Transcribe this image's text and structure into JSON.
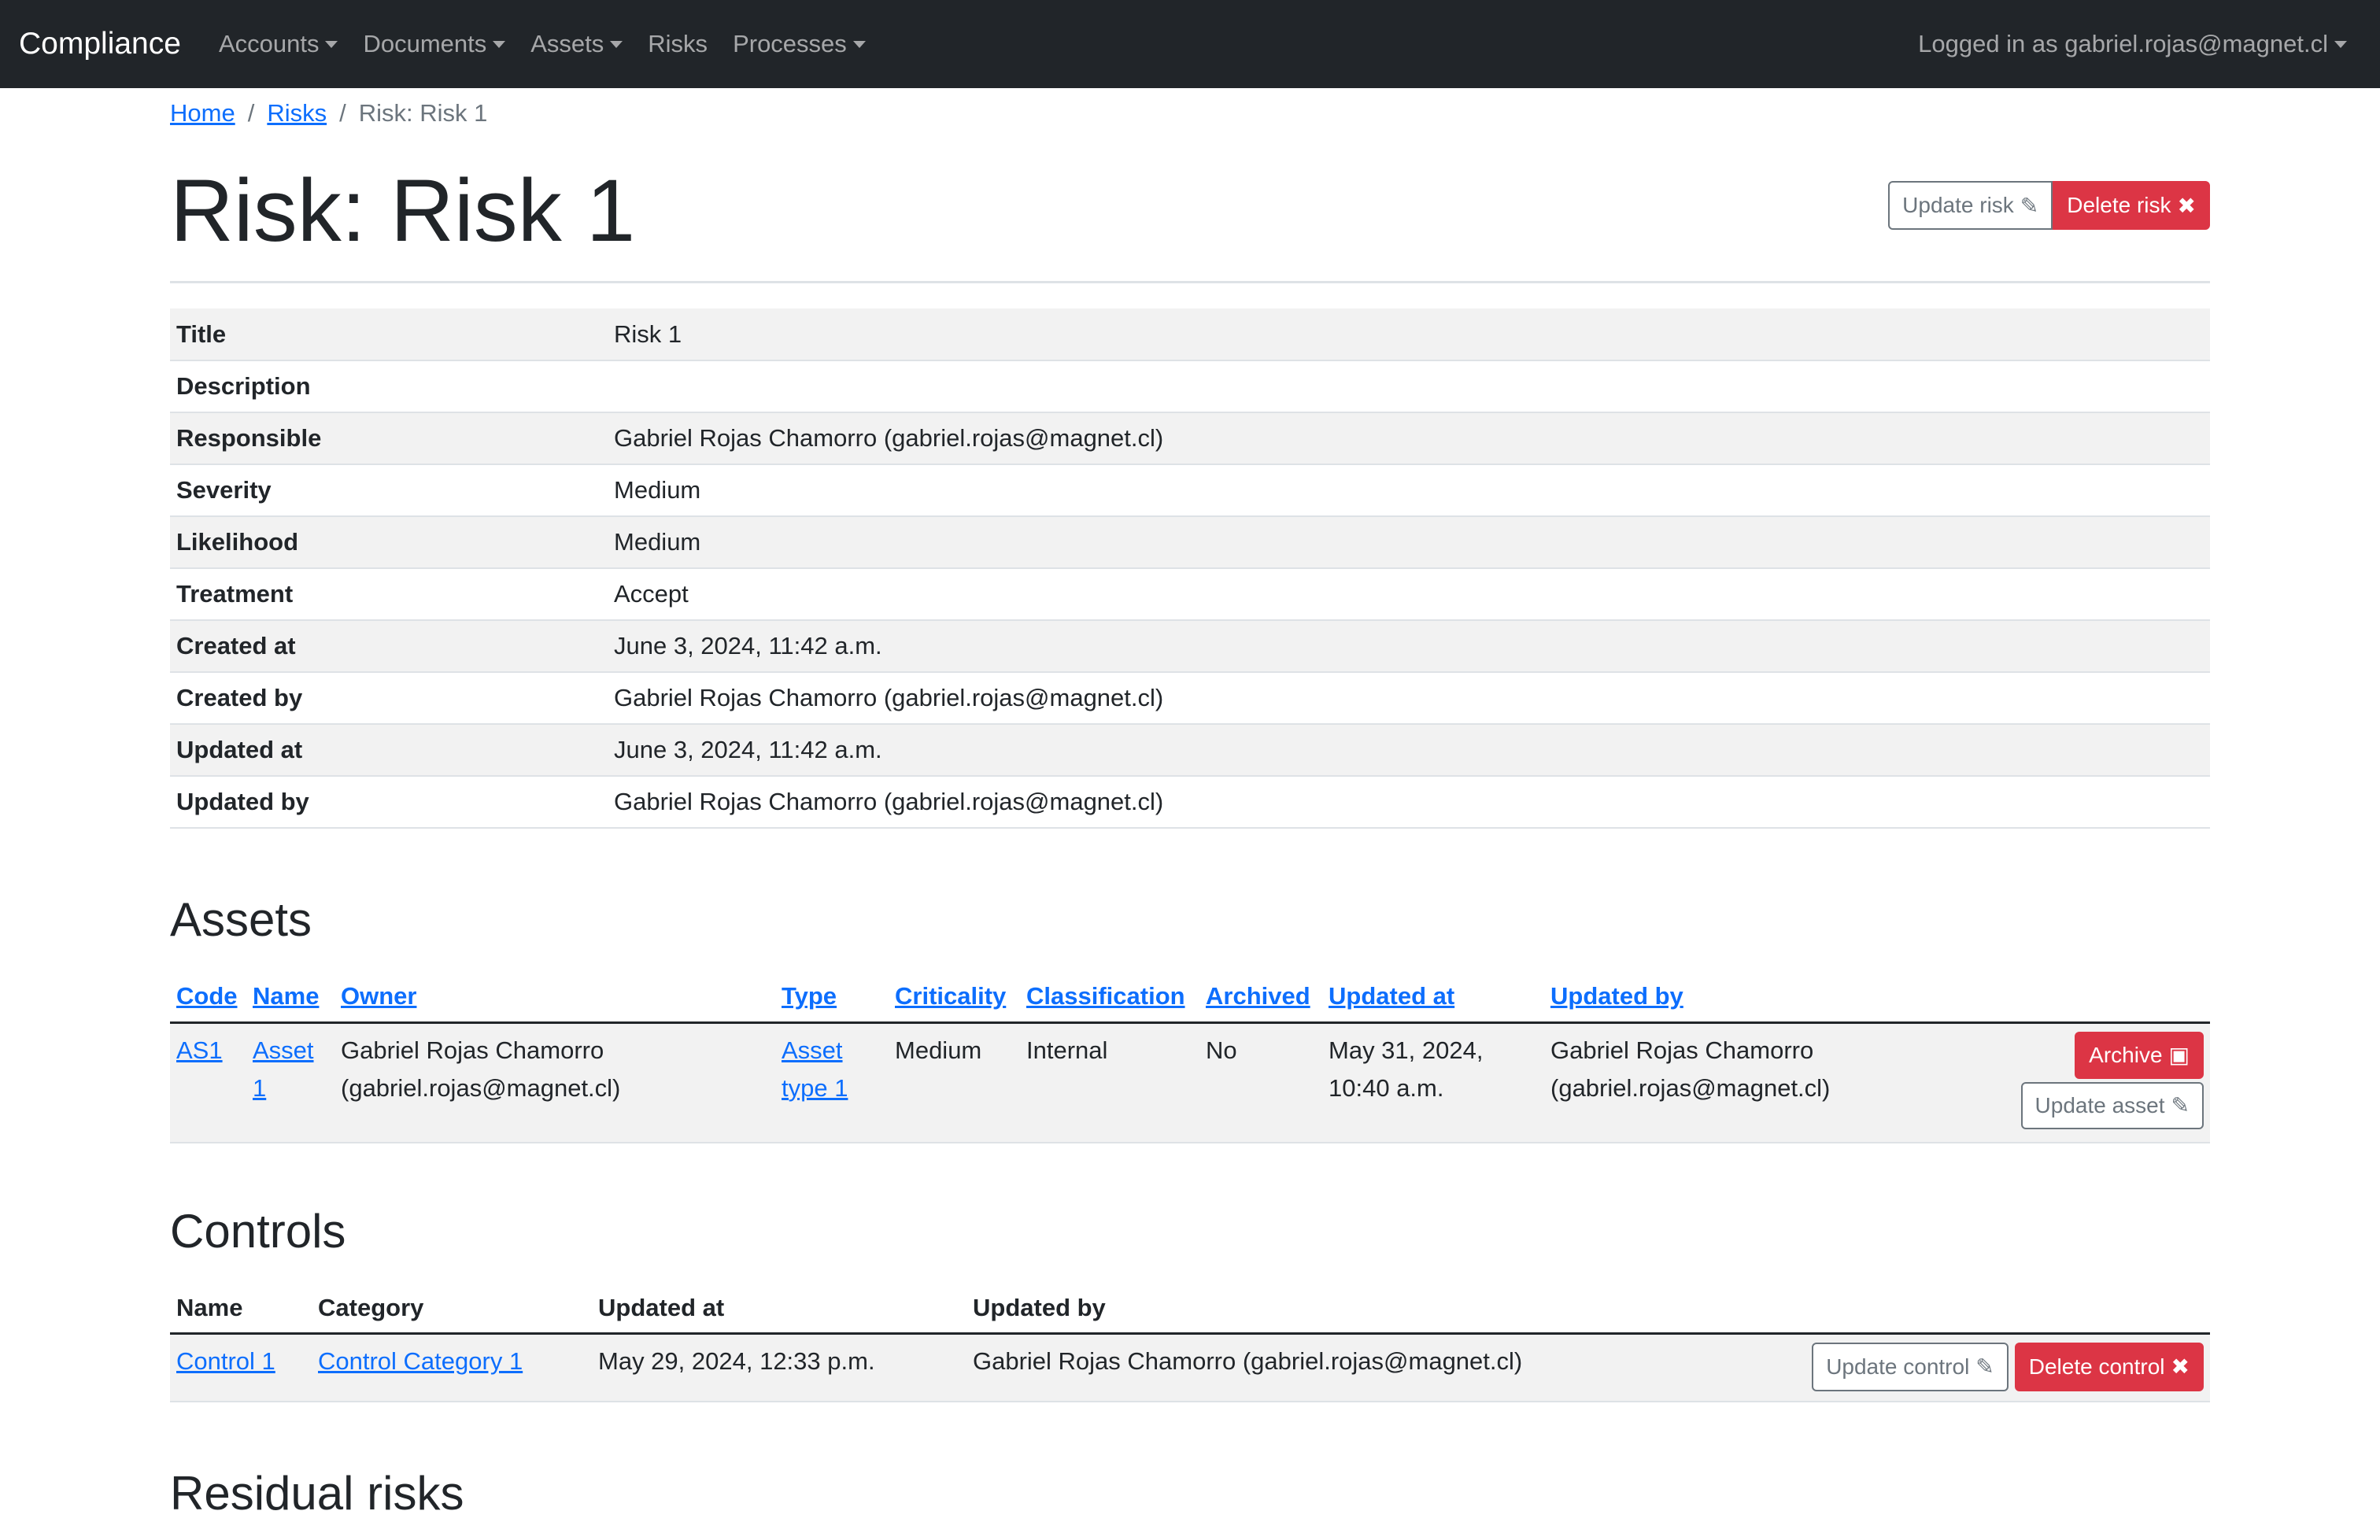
{
  "nav": {
    "brand": "Compliance",
    "items": [
      "Accounts",
      "Documents",
      "Assets",
      "Risks",
      "Processes"
    ],
    "user": "Logged in as gabriel.rojas@magnet.cl"
  },
  "breadcrumb": {
    "home": "Home",
    "risks": "Risks",
    "current": "Risk: Risk 1",
    "sep": "/"
  },
  "page": {
    "title": "Risk: Risk 1",
    "update_label": "Update risk",
    "delete_label": "Delete risk"
  },
  "details": [
    {
      "label": "Title",
      "value": "Risk 1"
    },
    {
      "label": "Description",
      "value": ""
    },
    {
      "label": "Responsible",
      "value": "Gabriel Rojas Chamorro (gabriel.rojas@magnet.cl)"
    },
    {
      "label": "Severity",
      "value": "Medium"
    },
    {
      "label": "Likelihood",
      "value": "Medium"
    },
    {
      "label": "Treatment",
      "value": "Accept"
    },
    {
      "label": "Created at",
      "value": "June 3, 2024, 11:42 a.m."
    },
    {
      "label": "Created by",
      "value": "Gabriel Rojas Chamorro (gabriel.rojas@magnet.cl)"
    },
    {
      "label": "Updated at",
      "value": "June 3, 2024, 11:42 a.m."
    },
    {
      "label": "Updated by",
      "value": "Gabriel Rojas Chamorro (gabriel.rojas@magnet.cl)"
    }
  ],
  "assets": {
    "heading": "Assets",
    "columns": [
      "Code",
      "Name",
      "Owner",
      "Type",
      "Criticality",
      "Classification",
      "Archived",
      "Updated at",
      "Updated by"
    ],
    "rows": [
      {
        "code": "AS1",
        "name": "Asset 1",
        "owner": "Gabriel Rojas Chamorro (gabriel.rojas@magnet.cl)",
        "type": "Asset type 1",
        "criticality": "Medium",
        "classification": "Internal",
        "archived": "No",
        "updated_at": "May 31, 2024, 10:40 a.m.",
        "updated_by": "Gabriel Rojas Chamorro (gabriel.rojas@magnet.cl)",
        "archive_label": "Archive",
        "update_label": "Update asset"
      }
    ]
  },
  "controls": {
    "heading": "Controls",
    "columns": [
      "Name",
      "Category",
      "Updated at",
      "Updated by"
    ],
    "rows": [
      {
        "name": "Control 1",
        "category": "Control Category 1",
        "updated_at": "May 29, 2024, 12:33 p.m.",
        "updated_by": "Gabriel Rojas Chamorro (gabriel.rojas@magnet.cl)",
        "update_label": "Update control",
        "delete_label": "Delete control"
      }
    ]
  },
  "residual": {
    "heading": "Residual risks"
  },
  "colors": {
    "navbar": "#212529",
    "link": "#0d6efd",
    "danger": "#dc3545",
    "secondary": "#6c757d"
  }
}
